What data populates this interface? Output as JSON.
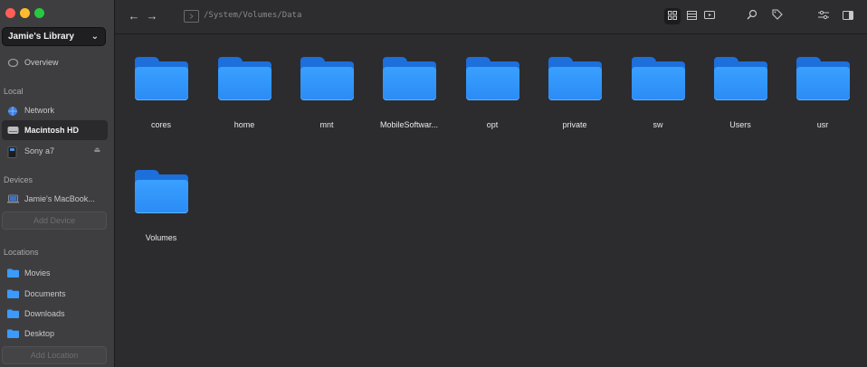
{
  "sidebar": {
    "library_title": "Jamie's Library",
    "overview_label": "Overview",
    "sections": {
      "local": "Local",
      "devices": "Devices",
      "locations": "Locations"
    },
    "local_items": [
      {
        "label": "Network"
      },
      {
        "label": "Macintosh HD"
      },
      {
        "label": "Sony a7"
      }
    ],
    "device_items": [
      {
        "label": "Jamie's MacBook..."
      }
    ],
    "add_device_label": "Add Device",
    "location_items": [
      {
        "label": "Movies"
      },
      {
        "label": "Documents"
      },
      {
        "label": "Downloads"
      },
      {
        "label": "Desktop"
      }
    ],
    "add_location_label": "Add Location"
  },
  "toolbar": {
    "path": "/System/Volumes/Data"
  },
  "folders": [
    {
      "name": "cores"
    },
    {
      "name": "home"
    },
    {
      "name": "mnt"
    },
    {
      "name": "MobileSoftwar..."
    },
    {
      "name": "opt"
    },
    {
      "name": "private"
    },
    {
      "name": "sw"
    },
    {
      "name": "Users"
    },
    {
      "name": "usr"
    },
    {
      "name": "Volumes"
    }
  ],
  "colors": {
    "folder_blue": "#2a8bf5",
    "accent_close": "#fe5f57",
    "accent_min": "#febc2e",
    "accent_max": "#28c840"
  }
}
